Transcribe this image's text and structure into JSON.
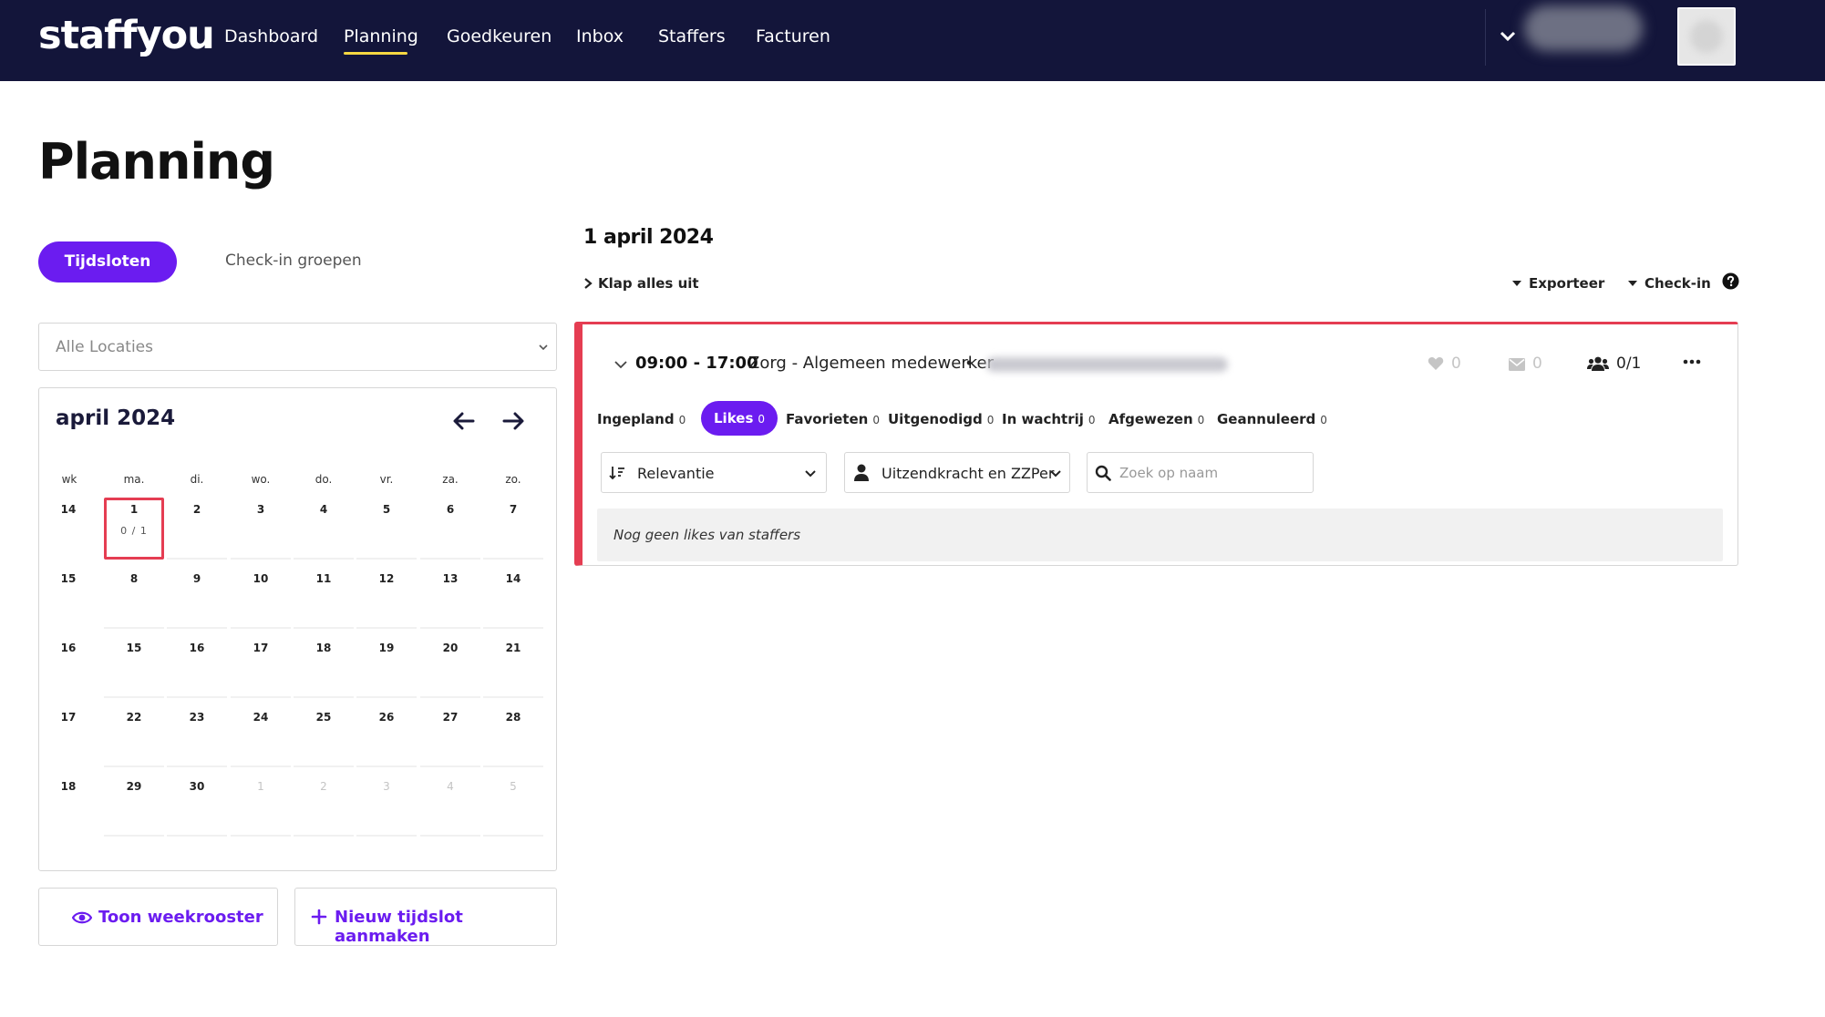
{
  "app": {
    "logo": "staffyou"
  },
  "nav": {
    "items": [
      "Dashboard",
      "Planning",
      "Goedkeuren",
      "Inbox",
      "Staffers",
      "Facturen"
    ],
    "active": "Planning"
  },
  "page": {
    "title": "Planning"
  },
  "tabs": {
    "active": "Tijdsloten",
    "inactive": "Check-in groepen"
  },
  "location": {
    "value": "Alle Locaties"
  },
  "calendar": {
    "month_label": "april 2024",
    "headers": [
      "wk",
      "ma.",
      "di.",
      "wo.",
      "do.",
      "vr.",
      "za.",
      "zo."
    ],
    "weeks": [
      {
        "wk": "14",
        "days": [
          "1",
          "2",
          "3",
          "4",
          "5",
          "6",
          "7"
        ]
      },
      {
        "wk": "15",
        "days": [
          "8",
          "9",
          "10",
          "11",
          "12",
          "13",
          "14"
        ]
      },
      {
        "wk": "16",
        "days": [
          "15",
          "16",
          "17",
          "18",
          "19",
          "20",
          "21"
        ]
      },
      {
        "wk": "17",
        "days": [
          "22",
          "23",
          "24",
          "25",
          "26",
          "27",
          "28"
        ]
      },
      {
        "wk": "18",
        "days": [
          "29",
          "30",
          "1",
          "2",
          "3",
          "4",
          "5"
        ]
      }
    ],
    "selected_sub": "0 / 1"
  },
  "buttons": {
    "week_view": "Toon weekrooster",
    "new_slot": "Nieuw tijdslot aanmaken"
  },
  "detail": {
    "date": "1 april 2024",
    "collapse_all": "Klap alles uit",
    "export": "Exporteer",
    "checkin": "Check-in"
  },
  "shift": {
    "time": "09:00 - 17:00",
    "role": "Zorg - Algemeen medewerker",
    "likes": "0",
    "messages": "0",
    "staff": "0/1"
  },
  "subtabs": [
    {
      "label": "Ingepland",
      "count": "0"
    },
    {
      "label": "Likes",
      "count": "0"
    },
    {
      "label": "Favorieten",
      "count": "0"
    },
    {
      "label": "Uitgenodigd",
      "count": "0"
    },
    {
      "label": "In wachtrij",
      "count": "0"
    },
    {
      "label": "Afgewezen",
      "count": "0"
    },
    {
      "label": "Geannuleerd",
      "count": "0"
    }
  ],
  "filters": {
    "sort": "Relevantie",
    "type": "Uitzendkracht en ZZPer",
    "search_placeholder": "Zoek op naam"
  },
  "empty_message": "Nog geen likes van staffers",
  "colors": {
    "nav_bg": "#13153a",
    "accent": "#6b1cf0",
    "alert": "#e53d52",
    "underline": "#f5d742"
  }
}
